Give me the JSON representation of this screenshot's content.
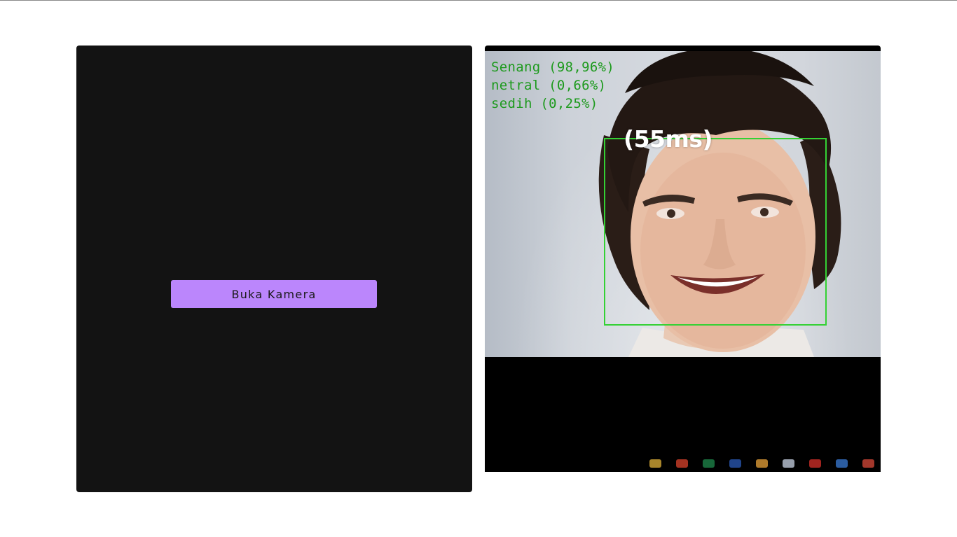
{
  "left_panel": {
    "button_label": "Buka Kamera",
    "button_color": "#bb86fc",
    "background": "#131313"
  },
  "camera_view": {
    "emotions": [
      {
        "text": "Senang (98,96%)"
      },
      {
        "text": "netral (0,66%)"
      },
      {
        "text": "sedih (0,25%)"
      }
    ],
    "latency": "(55ms)",
    "overlay_text_color": "#1d9a1d",
    "face_box_color": "#34d134",
    "taskbar_icons": [
      {
        "name": "folder-icon",
        "color": "#e0b23a"
      },
      {
        "name": "app-icon",
        "color": "#d9432c"
      },
      {
        "name": "excel-icon",
        "color": "#1f8a4c"
      },
      {
        "name": "word-icon",
        "color": "#2b5bb8"
      },
      {
        "name": "chrome-icon",
        "color": "#e8a33a"
      },
      {
        "name": "browser-icon",
        "color": "#c9d4e6"
      },
      {
        "name": "pdf-icon",
        "color": "#d6302a"
      },
      {
        "name": "app2-icon",
        "color": "#3a7bd5"
      },
      {
        "name": "app3-icon",
        "color": "#d94a3a"
      }
    ]
  }
}
